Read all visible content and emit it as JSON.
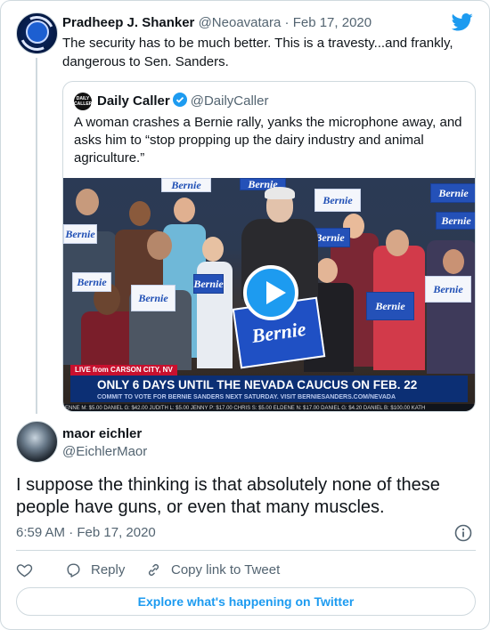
{
  "parent": {
    "name": "Pradheep J. Shanker",
    "handle": "@Neoavatara",
    "separator": "·",
    "date": "Feb 17, 2020",
    "text": "The security has to be much better.  This is a travesty...and frankly, dangerous to Sen. Sanders."
  },
  "quote": {
    "avatar_text": "DAILY CALLER",
    "name": "Daily Caller",
    "handle": "@DailyCaller",
    "text": "A woman crashes a Bernie rally, yanks the microphone away, and asks him to “stop propping up the dairy industry and animal agriculture.”",
    "media": {
      "signs": [
        "Bernie",
        "Bernie",
        "Bernie",
        "Bernie",
        "Bernie",
        "Bernie",
        "Bernie",
        "Bernie",
        "Bernie",
        "Bernie",
        "Bernie",
        "Bernie"
      ],
      "podium_sign": "Bernie",
      "chyron_live": "LIVE from CARSON CITY, NV",
      "chyron_main": "ONLY 6 DAYS UNTIL THE NEVADA CAUCUS ON FEB. 22",
      "chyron_sub": "COMMIT TO VOTE FOR BERNIE SANDERS NEXT SATURDAY. VISIT BERNIESANDERS.COM/NEVADA",
      "ticker": "ENNE M: $5.00   DANIEL G: $42.00   JUDITH L: $5.00   JENNY P: $17.00   CHRIS S: $5.00   ELDENE N: $17.00   DANIEL G: $4.20   DANIEL B: $100.00   KATH"
    }
  },
  "reply": {
    "name": "maor eichler",
    "handle": "@EichlerMaor",
    "text": "I suppose the thinking is that absolutely none of these people have guns, or even that many muscles.",
    "time": "6:59 AM · Feb 17, 2020"
  },
  "actions": {
    "reply_label": "Reply",
    "copy_label": "Copy link to Tweet"
  },
  "explore_label": "Explore what's happening on Twitter",
  "colors": {
    "accent": "#1d9bf0",
    "text": "#0f1419",
    "muted": "#536471",
    "border": "#cfd9de"
  },
  "icons": [
    "twitter-bird-icon",
    "verified-badge-icon",
    "play-icon",
    "info-icon",
    "heart-icon",
    "reply-icon",
    "link-icon"
  ]
}
